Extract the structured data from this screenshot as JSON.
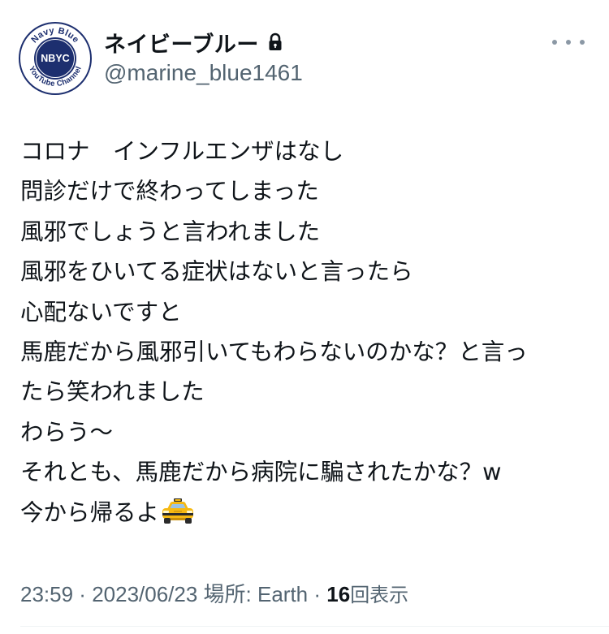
{
  "user": {
    "avatar_text_top": "Navy Blue",
    "avatar_text_center": "NBYC",
    "avatar_text_bottom": "YouTube Channel",
    "display_name": "ネイビーブルー",
    "handle": "@marine_blue1461",
    "protected_icon": "lock-icon"
  },
  "tweet": {
    "lines": [
      "コロナ　インフルエンザはなし",
      "問診だけで終わってしまった",
      "風邪でしょうと言われました",
      "風邪をひいてる症状はないと言ったら",
      "心配ないですと",
      "馬鹿だから風邪引いてもわらないのかな？と言っ",
      "たら笑われました",
      "わらう〜",
      "それとも、馬鹿だから病院に騙されたかな？w",
      "今から帰るよ"
    ],
    "emoji": "taxi-icon"
  },
  "meta": {
    "time": "23:59",
    "sep1": " · ",
    "date": "2023/06/23",
    "location": " 場所: Earth",
    "sep2": " · ",
    "views_count": "16",
    "views_label": "回表示"
  },
  "colors": {
    "text": "#0f1419",
    "secondary": "#536471",
    "avatar_navy": "#1d2f6f",
    "taxi_yellow": "#f6b913"
  }
}
